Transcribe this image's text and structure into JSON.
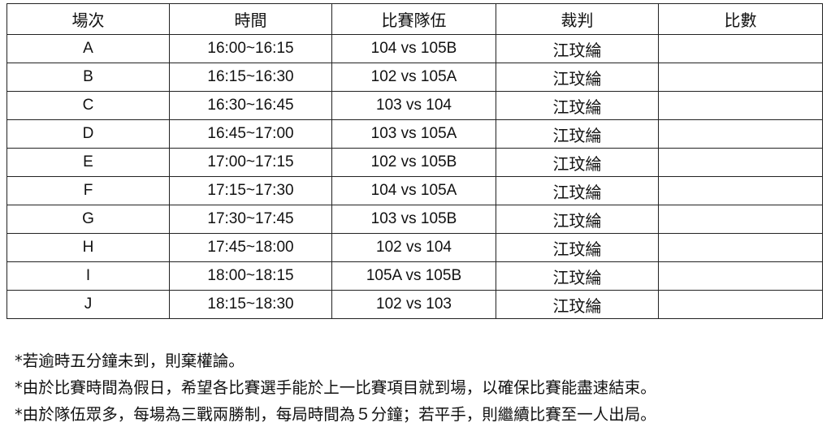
{
  "headers": [
    "場次",
    "時間",
    "比賽隊伍",
    "裁判",
    "比數"
  ],
  "rows": [
    {
      "round": "A",
      "time": "16:00~16:15",
      "match": "104 vs 105B",
      "referee": "江玟綸",
      "score": ""
    },
    {
      "round": "B",
      "time": "16:15~16:30",
      "match": "102 vs 105A",
      "referee": "江玟綸",
      "score": ""
    },
    {
      "round": "C",
      "time": "16:30~16:45",
      "match": "103 vs 104",
      "referee": "江玟綸",
      "score": ""
    },
    {
      "round": "D",
      "time": "16:45~17:00",
      "match": "103 vs 105A",
      "referee": "江玟綸",
      "score": ""
    },
    {
      "round": "E",
      "time": "17:00~17:15",
      "match": "102 vs 105B",
      "referee": "江玟綸",
      "score": ""
    },
    {
      "round": "F",
      "time": "17:15~17:30",
      "match": "104 vs 105A",
      "referee": "江玟綸",
      "score": ""
    },
    {
      "round": "G",
      "time": "17:30~17:45",
      "match": "103 vs 105B",
      "referee": "江玟綸",
      "score": ""
    },
    {
      "round": "H",
      "time": "17:45~18:00",
      "match": "102 vs 104",
      "referee": "江玟綸",
      "score": ""
    },
    {
      "round": "I",
      "time": "18:00~18:15",
      "match": "105A vs 105B",
      "referee": "江玟綸",
      "score": ""
    },
    {
      "round": "J",
      "time": "18:15~18:30",
      "match": "102 vs 103",
      "referee": "江玟綸",
      "score": ""
    }
  ],
  "notes": [
    "*若逾時五分鐘未到，則棄權論。",
    "*由於比賽時間為假日，希望各比賽選手能於上一比賽項目就到場，以確保比賽能盡速結束。",
    "*由於隊伍眾多，每場為三戰兩勝制，每局時間為５分鐘；若平手，則繼續比賽至一人出局。"
  ]
}
